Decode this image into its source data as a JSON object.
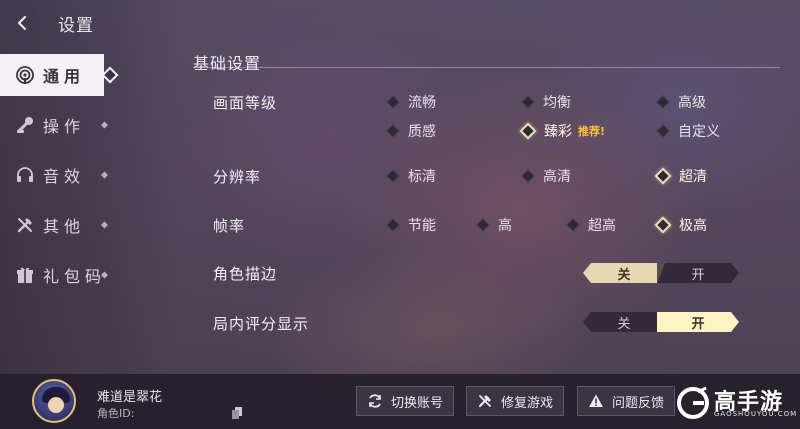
{
  "header": {
    "title": "设置"
  },
  "sidebar": {
    "items": [
      {
        "label": "通用",
        "icon": "broadcast-icon",
        "active": true
      },
      {
        "label": "操作",
        "icon": "joystick-icon",
        "active": false
      },
      {
        "label": "音效",
        "icon": "headphones-icon",
        "active": false
      },
      {
        "label": "其他",
        "icon": "tools-icon",
        "active": false
      },
      {
        "label": "礼包码",
        "icon": "gift-icon",
        "active": false
      }
    ]
  },
  "settings": {
    "section_title": "基础设置",
    "quality": {
      "label": "画面等级",
      "options": [
        "流畅",
        "均衡",
        "高级",
        "质感",
        "臻彩",
        "自定义"
      ],
      "selected": "臻彩",
      "recommend_tag": "推荐!"
    },
    "resolution": {
      "label": "分辨率",
      "options": [
        "标清",
        "高清",
        "超清"
      ],
      "selected": "超清"
    },
    "framerate": {
      "label": "帧率",
      "options": [
        "节能",
        "高",
        "超高",
        "极高"
      ],
      "selected": "极高"
    },
    "outline": {
      "label": "角色描边",
      "off": "关",
      "on": "开",
      "value": "关"
    },
    "score_display": {
      "label": "局内评分显示",
      "off": "关",
      "on": "开",
      "value": "开"
    }
  },
  "footer": {
    "player_name": "难道是翠花",
    "player_id_label": "角色ID:",
    "buttons": {
      "switch_account": "切换账号",
      "repair_game": "修复游戏",
      "feedback": "问题反馈"
    },
    "logo": {
      "text": "高手游",
      "sub": "GAOSHOUYOU.COM"
    }
  },
  "colors": {
    "selected_border": "#f3dfb0",
    "recommend": "#ffc23b",
    "toggle_on_left": "#e9d7b4",
    "toggle_on_right": "#fff3c4"
  }
}
